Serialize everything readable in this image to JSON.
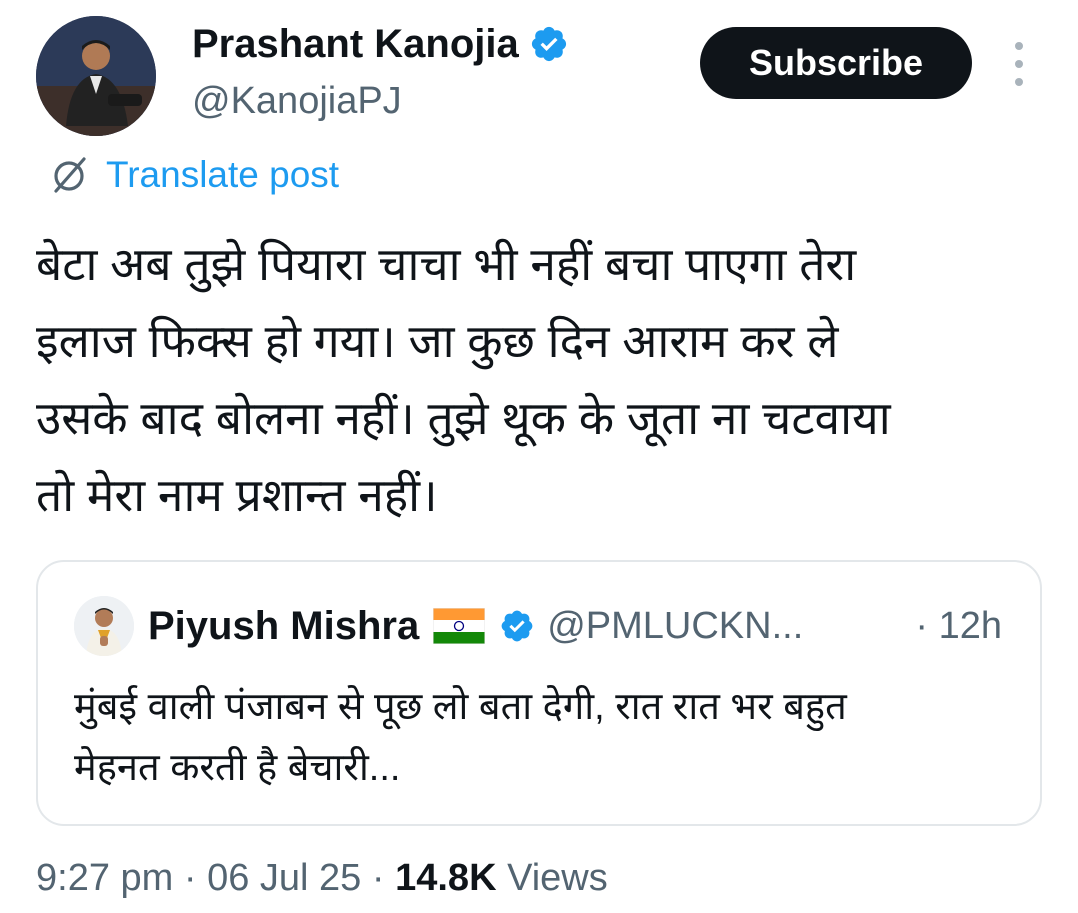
{
  "author": {
    "name": "Prashant Kanojia",
    "handle": "@KanojiaPJ",
    "verified": true
  },
  "subscribe_label": "Subscribe",
  "translate_label": "Translate post",
  "post_lines": [
    "बेटा अब तुझे पियारा चाचा भी नहीं बचा पाएगा तेरा",
    "इलाज फिक्स हो गया। जा कुछ दिन आराम कर ले",
    "उसके बाद बोलना नहीं। तुझे थूक के जूता ना चटवाया",
    "तो मेरा नाम प्रशान्त नहीं।"
  ],
  "quoted": {
    "name": "Piyush Mishra",
    "handle": "@PMLUCKN...",
    "time": "· 12h",
    "verified": true,
    "lines": [
      "मुंबई वाली पंजाबन से पूछ लो बता देगी, रात रात भर बहुत",
      "मेहनत करती है बेचारी..."
    ]
  },
  "meta": {
    "time": "9:27 pm",
    "sep1": " · ",
    "date": "06 Jul 25",
    "sep2": " · ",
    "views_count": "14.8K",
    "views_label": " Views"
  },
  "colors": {
    "accent": "#1d9bf0",
    "text": "#0f1419",
    "secondary": "#536471",
    "border": "#e3e7ea"
  }
}
